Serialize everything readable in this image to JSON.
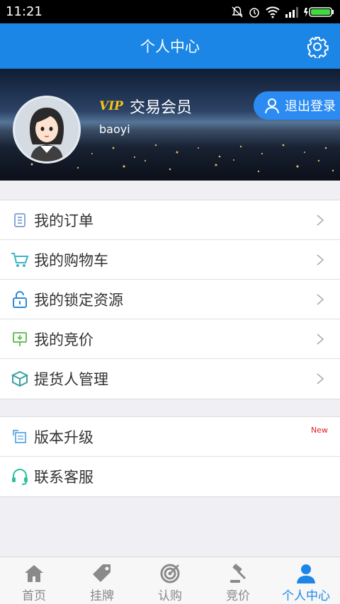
{
  "status_bar": {
    "time": "11:21"
  },
  "header": {
    "title": "个人中心"
  },
  "profile": {
    "vip_badge": "VIP",
    "member_type": "交易会员",
    "username": "baoyi",
    "logout_label": "退出登录"
  },
  "menu_group_1": [
    {
      "label": "我的订单",
      "icon": "order-list-icon"
    },
    {
      "label": "我的购物车",
      "icon": "shopping-cart-icon"
    },
    {
      "label": "我的锁定资源",
      "icon": "lock-icon"
    },
    {
      "label": "我的竞价",
      "icon": "bid-icon"
    },
    {
      "label": "提货人管理",
      "icon": "box-icon"
    }
  ],
  "menu_group_2": [
    {
      "label": "版本升级",
      "icon": "upgrade-icon",
      "badge": "New"
    },
    {
      "label": "联系客服",
      "icon": "headset-icon"
    }
  ],
  "tabs": [
    {
      "label": "首页",
      "icon": "home-icon"
    },
    {
      "label": "挂牌",
      "icon": "tag-icon"
    },
    {
      "label": "认购",
      "icon": "target-icon"
    },
    {
      "label": "竞价",
      "icon": "gavel-icon"
    },
    {
      "label": "个人中心",
      "icon": "user-icon",
      "active": true
    }
  ],
  "colors": {
    "primary": "#1c86e6",
    "badge_new": "#e02020",
    "vip": "#f5c518"
  }
}
